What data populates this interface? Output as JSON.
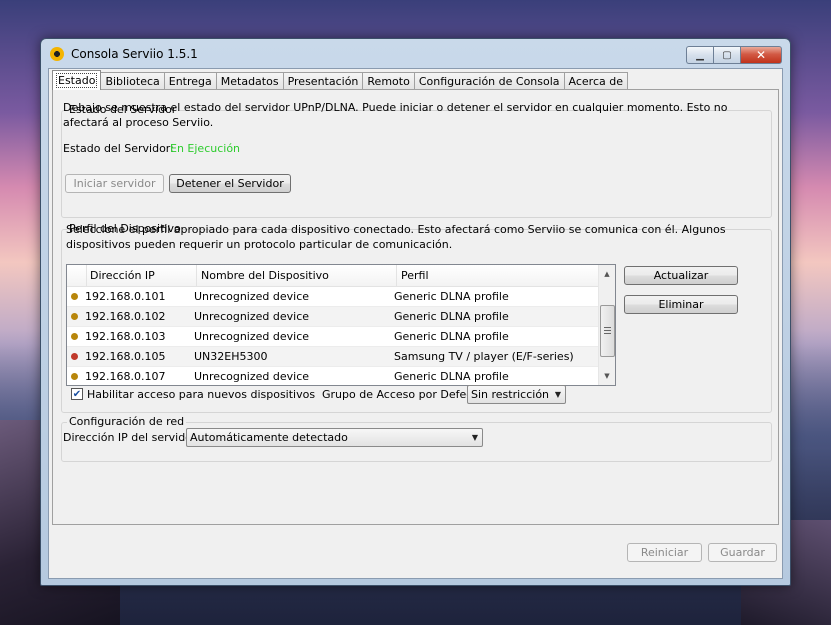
{
  "window": {
    "title": "Consola Serviio 1.5.1",
    "minimize_icon": "minimize-icon",
    "maximize_icon": "maximize-icon",
    "close_icon": "close-icon"
  },
  "tabs": [
    {
      "label": "Estado",
      "active": true
    },
    {
      "label": "Biblioteca"
    },
    {
      "label": "Entrega"
    },
    {
      "label": "Metadatos"
    },
    {
      "label": "Presentación"
    },
    {
      "label": "Remoto"
    },
    {
      "label": "Configuración de Consola"
    },
    {
      "label": "Acerca de"
    }
  ],
  "server": {
    "group_title": "Estado del Servidor",
    "description": "Debajo se muestra el estado del servidor UPnP/DLNA. Puede iniciar o detener el servidor en cualquier momento. Esto no afectará al proceso Serviio.",
    "status_label": "Estado del Servidor:",
    "status_value": "En Ejecución",
    "start_button": "Iniciar servidor",
    "stop_button": "Detener el Servidor"
  },
  "profile": {
    "group_title": "Perfil del Dispositivo",
    "description": "Seleccione el perfil apropiado para cada dispositivo conectado. Esto afectará como Serviio se comunica con él.  Algunos dispositivos pueden requerir un protocolo particular de comunicación.",
    "columns": [
      "Dirección IP",
      "Nombre del Dispositivo",
      "Perfil"
    ],
    "rows": [
      {
        "status_color": "#b8860b",
        "ip": "192.168.0.101",
        "name": "Unrecognized device",
        "profile": "Generic DLNA profile"
      },
      {
        "status_color": "#b8860b",
        "ip": "192.168.0.102",
        "name": "Unrecognized device",
        "profile": "Generic DLNA profile"
      },
      {
        "status_color": "#b8860b",
        "ip": "192.168.0.103",
        "name": "Unrecognized device",
        "profile": "Generic DLNA profile"
      },
      {
        "status_color": "#c0392b",
        "ip": "192.168.0.105",
        "name": "UN32EH5300",
        "profile": "Samsung TV / player (E/F-series)"
      },
      {
        "status_color": "#b8860b",
        "ip": "192.168.0.107",
        "name": "Unrecognized device",
        "profile": "Generic DLNA profile"
      }
    ],
    "update_button": "Actualizar",
    "delete_button": "Eliminar",
    "enable_access_label": "Habilitar acceso para nuevos dispositivos",
    "enable_access_checked": true,
    "default_group_label": "Grupo de Acceso por Defecto",
    "default_group_value": "Sin restricción"
  },
  "network": {
    "group_title": "Configuración de red",
    "ip_label": "Dirección IP del servidor",
    "ip_value": "Automáticamente detectado"
  },
  "footer": {
    "reset_button": "Reiniciar",
    "save_button": "Guardar"
  },
  "colors": {
    "running": "#2ecc2e"
  }
}
